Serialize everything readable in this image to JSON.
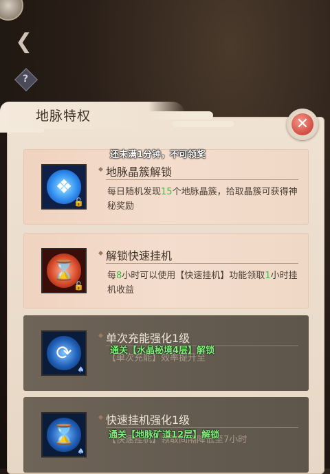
{
  "panel": {
    "title": "地脉特权",
    "close_icon": "close-x-icon"
  },
  "toast": "还未满1分钟，不可领奖",
  "nav": {
    "back_icon": "back-arrow-icon",
    "help_icon": "question-icon",
    "help_glyph": "?"
  },
  "cards": [
    {
      "title": "地脉晶簇解锁",
      "desc_parts": [
        "每日随机发现",
        "15",
        "个地脉晶簇，拾取晶簇可获得神秘奖励"
      ],
      "icon": "crystal-cluster-icon",
      "state": "unlocked"
    },
    {
      "title": "解锁快速挂机",
      "desc_parts": [
        "每",
        "8",
        "小时可以使用【快速挂机】功能领取",
        "1",
        "小时挂机收益"
      ],
      "icon": "hourglass-icon",
      "state": "unlocked"
    },
    {
      "title": "单次充能强化1级",
      "desc": "【单次充能】效率提升至",
      "unlock_req": "通关【水晶秘境4层】解锁",
      "icon": "recharge-icon",
      "state": "locked"
    },
    {
      "title": "快速挂机强化1级",
      "desc": "【快速挂机】领取间隔降低至7小时",
      "unlock_req": "通关【地脉矿道12层】解锁",
      "icon": "hourglass-icon",
      "state": "locked"
    }
  ],
  "colors": {
    "highlight_number": "#3fb84a",
    "unlock_text": "#7ff07a",
    "close_red": "#d9574c"
  }
}
